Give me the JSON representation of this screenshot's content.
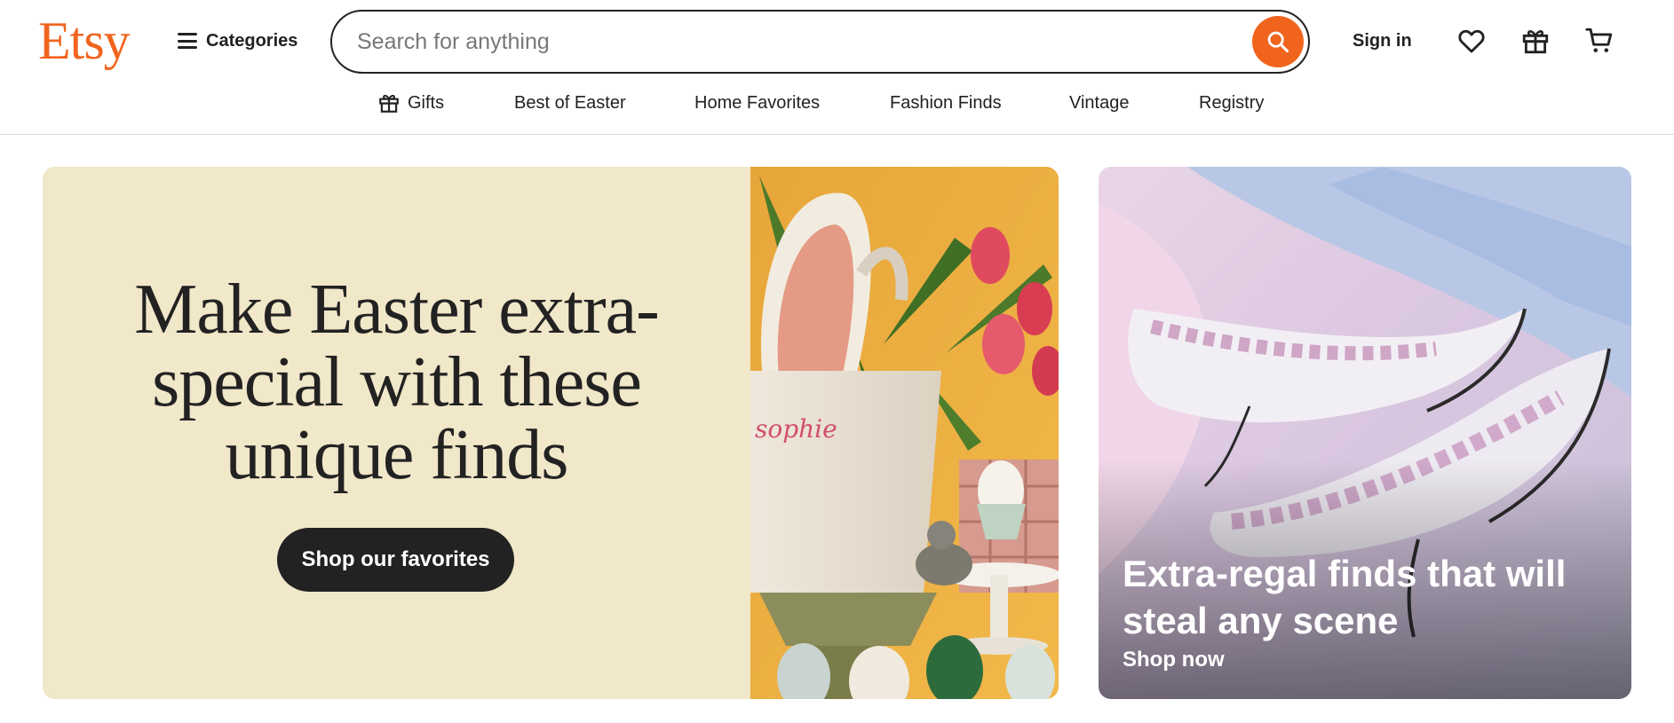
{
  "brand": {
    "logo_text": "Etsy",
    "accent_color": "#F1641E"
  },
  "header": {
    "categories_label": "Categories",
    "search": {
      "placeholder": "Search for anything",
      "value": ""
    },
    "signin_label": "Sign in",
    "icons": [
      "heart-icon",
      "gift-icon",
      "cart-icon"
    ]
  },
  "subnav": {
    "items": [
      {
        "label": "Gifts",
        "icon": "gift-icon"
      },
      {
        "label": "Best of Easter"
      },
      {
        "label": "Home Favorites"
      },
      {
        "label": "Fashion Finds"
      },
      {
        "label": "Vintage"
      },
      {
        "label": "Registry"
      }
    ]
  },
  "hero": {
    "main": {
      "heading": "Make Easter extra-special with these unique finds",
      "cta_label": "Shop our favorites",
      "background_color": "#F1E7C9",
      "image_text": "sophie"
    },
    "secondary": {
      "title": "Extra-regal finds that will steal any scene",
      "link_label": "Shop now"
    }
  }
}
